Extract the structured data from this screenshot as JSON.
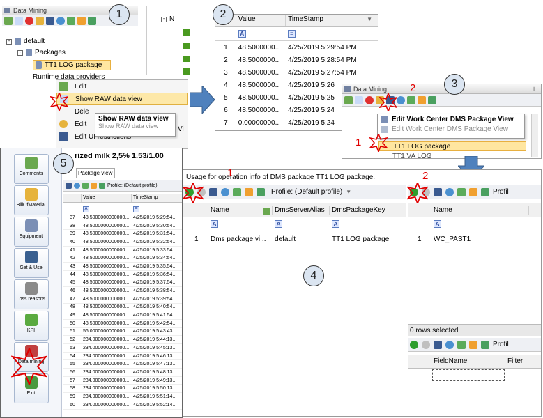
{
  "step_labels": [
    "1",
    "2",
    "3",
    "4",
    "5"
  ],
  "red_marks": [
    "2",
    "1",
    "1",
    "2"
  ],
  "panel1": {
    "title": "Data Mining",
    "tree": {
      "root": "default",
      "packages": "Packages",
      "selected_package": "TT1 LOG package",
      "runtime": "Runtime data providers"
    },
    "context_menu": [
      "Edit",
      "Show RAW data view",
      "Dele",
      "Edit",
      "Edit UI restrictions"
    ],
    "tooltip": {
      "title": "Show RAW data view",
      "subtitle": "Show RAW data view"
    },
    "right_tree_fragment": "N",
    "vi_fragment": "Vi"
  },
  "panel2": {
    "headers": [
      "Value",
      "TimeStamp"
    ],
    "rows": [
      {
        "n": "1",
        "value": "48.5000000...",
        "ts": "4/25/2019 5:29:54 PM"
      },
      {
        "n": "2",
        "value": "48.5000000...",
        "ts": "4/25/2019 5:28:54 PM"
      },
      {
        "n": "3",
        "value": "48.5000000...",
        "ts": "4/25/2019 5:27:54 PM"
      },
      {
        "n": "4",
        "value": "48.5000000...",
        "ts": "4/25/2019 5:26"
      },
      {
        "n": "5",
        "value": "48.5000000...",
        "ts": "4/25/2019 5:25"
      },
      {
        "n": "6",
        "value": "48.5000000...",
        "ts": "4/25/2019 5:24"
      },
      {
        "n": "7",
        "value": "0.00000000...",
        "ts": "4/25/2019 5:24"
      }
    ]
  },
  "panel3": {
    "title": "Data Mining",
    "menu": [
      "Edit Work Center DMS Package View",
      "Edit Work Center DMS Package View"
    ],
    "selected": "TT1 LOG package",
    "below": "TT1 VA LOG"
  },
  "panel4": {
    "caption": "Usage for operation info of DMS package TT1 LOG package.",
    "profile": "Profile: (Default profile)",
    "left_headers": [
      "Name",
      "DmsServerAlias",
      "DmsPackageKey"
    ],
    "left_rows": [
      {
        "n": "1",
        "name": "Dms package vi...",
        "alias": "default",
        "key": "TT1 LOG package"
      }
    ],
    "right_header": "Name",
    "right_rows": [
      {
        "n": "1",
        "name": "WC_PAST1"
      }
    ],
    "rows_selected": "0 rows selected",
    "field_headers": [
      "FieldName",
      "Filter"
    ],
    "profile_short": "Profil"
  },
  "panel5": {
    "title": "rized milk 2,5%  1.53/1.00",
    "tab": "Package view",
    "profile": "Profile: (Default profile)",
    "headers": [
      "Value",
      "TimeStamp"
    ],
    "sidebar": [
      "Comments",
      "BillOfMaterial",
      "Equipment",
      "Get & Use",
      "Loss reasons",
      "KPI",
      "Data mining",
      "Exit"
    ],
    "rows": [
      {
        "n": "37",
        "v": "48.5000000000000...",
        "t": "4/25/2019 5:29:54..."
      },
      {
        "n": "38",
        "v": "48.5000000000000...",
        "t": "4/25/2019 5:30:54..."
      },
      {
        "n": "39",
        "v": "48.5000000000000...",
        "t": "4/25/2019 5:31:54..."
      },
      {
        "n": "40",
        "v": "48.5000000000000...",
        "t": "4/25/2019 5:32:54..."
      },
      {
        "n": "41",
        "v": "48.5000000000000...",
        "t": "4/25/2019 5:33:54..."
      },
      {
        "n": "42",
        "v": "48.5000000000000...",
        "t": "4/25/2019 5:34:54..."
      },
      {
        "n": "43",
        "v": "48.5000000000000...",
        "t": "4/25/2019 5:35:54..."
      },
      {
        "n": "44",
        "v": "48.5000000000000...",
        "t": "4/25/2019 5:36:54..."
      },
      {
        "n": "45",
        "v": "48.5000000000000...",
        "t": "4/25/2019 5:37:54..."
      },
      {
        "n": "46",
        "v": "48.5000000000000...",
        "t": "4/25/2019 5:38:54..."
      },
      {
        "n": "47",
        "v": "48.5000000000000...",
        "t": "4/25/2019 5:39:54..."
      },
      {
        "n": "48",
        "v": "48.5000000000000...",
        "t": "4/25/2019 5:40:54..."
      },
      {
        "n": "49",
        "v": "48.5000000000000...",
        "t": "4/25/2019 5:41:54..."
      },
      {
        "n": "50",
        "v": "48.5000000000000...",
        "t": "4/25/2019 5:42:54..."
      },
      {
        "n": "51",
        "v": "56.0000000000000...",
        "t": "4/25/2019 5:43:43..."
      },
      {
        "n": "52",
        "v": "234.000000000000...",
        "t": "4/25/2019 5:44:13..."
      },
      {
        "n": "53",
        "v": "234.000000000000...",
        "t": "4/25/2019 5:45:13..."
      },
      {
        "n": "54",
        "v": "234.000000000000...",
        "t": "4/25/2019 5:46:13..."
      },
      {
        "n": "55",
        "v": "234.000000000000...",
        "t": "4/25/2019 5:47:13..."
      },
      {
        "n": "56",
        "v": "234.000000000000...",
        "t": "4/25/2019 5:48:13..."
      },
      {
        "n": "57",
        "v": "234.000000000000...",
        "t": "4/25/2019 5:49:13..."
      },
      {
        "n": "58",
        "v": "234.000000000000...",
        "t": "4/25/2019 5:50:13..."
      },
      {
        "n": "59",
        "v": "234.000000000000...",
        "t": "4/25/2019 5:51:14..."
      },
      {
        "n": "60",
        "v": "234.000000000000...",
        "t": "4/25/2019 5:52:14..."
      }
    ]
  }
}
